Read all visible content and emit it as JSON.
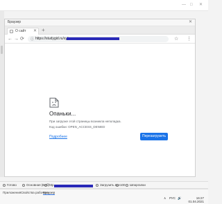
{
  "host": {
    "window_controls": [
      "—",
      "□",
      "✕"
    ]
  },
  "browser": {
    "window_title": "Браузер",
    "window_close": "✕",
    "tab": {
      "label": "О сайт",
      "close": "✕"
    },
    "new_tab": "+",
    "nav": {
      "back": "←",
      "forward": "→",
      "reload": "⟳"
    },
    "address": {
      "lock": "ⓘ",
      "url_prefix": "https://studygid.ru/sy/"
    },
    "nav_right": [
      "☆",
      "⋮"
    ]
  },
  "error_page": {
    "title": "Опаньки...",
    "description": "При загрузке этой страницы возникла неполадка.",
    "code": "Код ошибки: OPEN_ACCESS_DENIED",
    "link": "Подробнее",
    "button": "Перезагрузить"
  },
  "status_bar": {
    "items": [
      "Готово",
      "Основная (Веб)",
      "http",
      "Загрузить все",
      "100",
      "Шпаргалки"
    ]
  },
  "taskbar": {
    "items": [
      "Приложения",
      "Свойства рабочего",
      "Браузер"
    ],
    "active_index": 2,
    "tray": [
      "∧",
      "РУС",
      "🔊"
    ],
    "time": "16:27",
    "date": "01.04.2021"
  },
  "colors": {
    "accent": "#1a73e8",
    "redaction": "#2a2ab8"
  }
}
